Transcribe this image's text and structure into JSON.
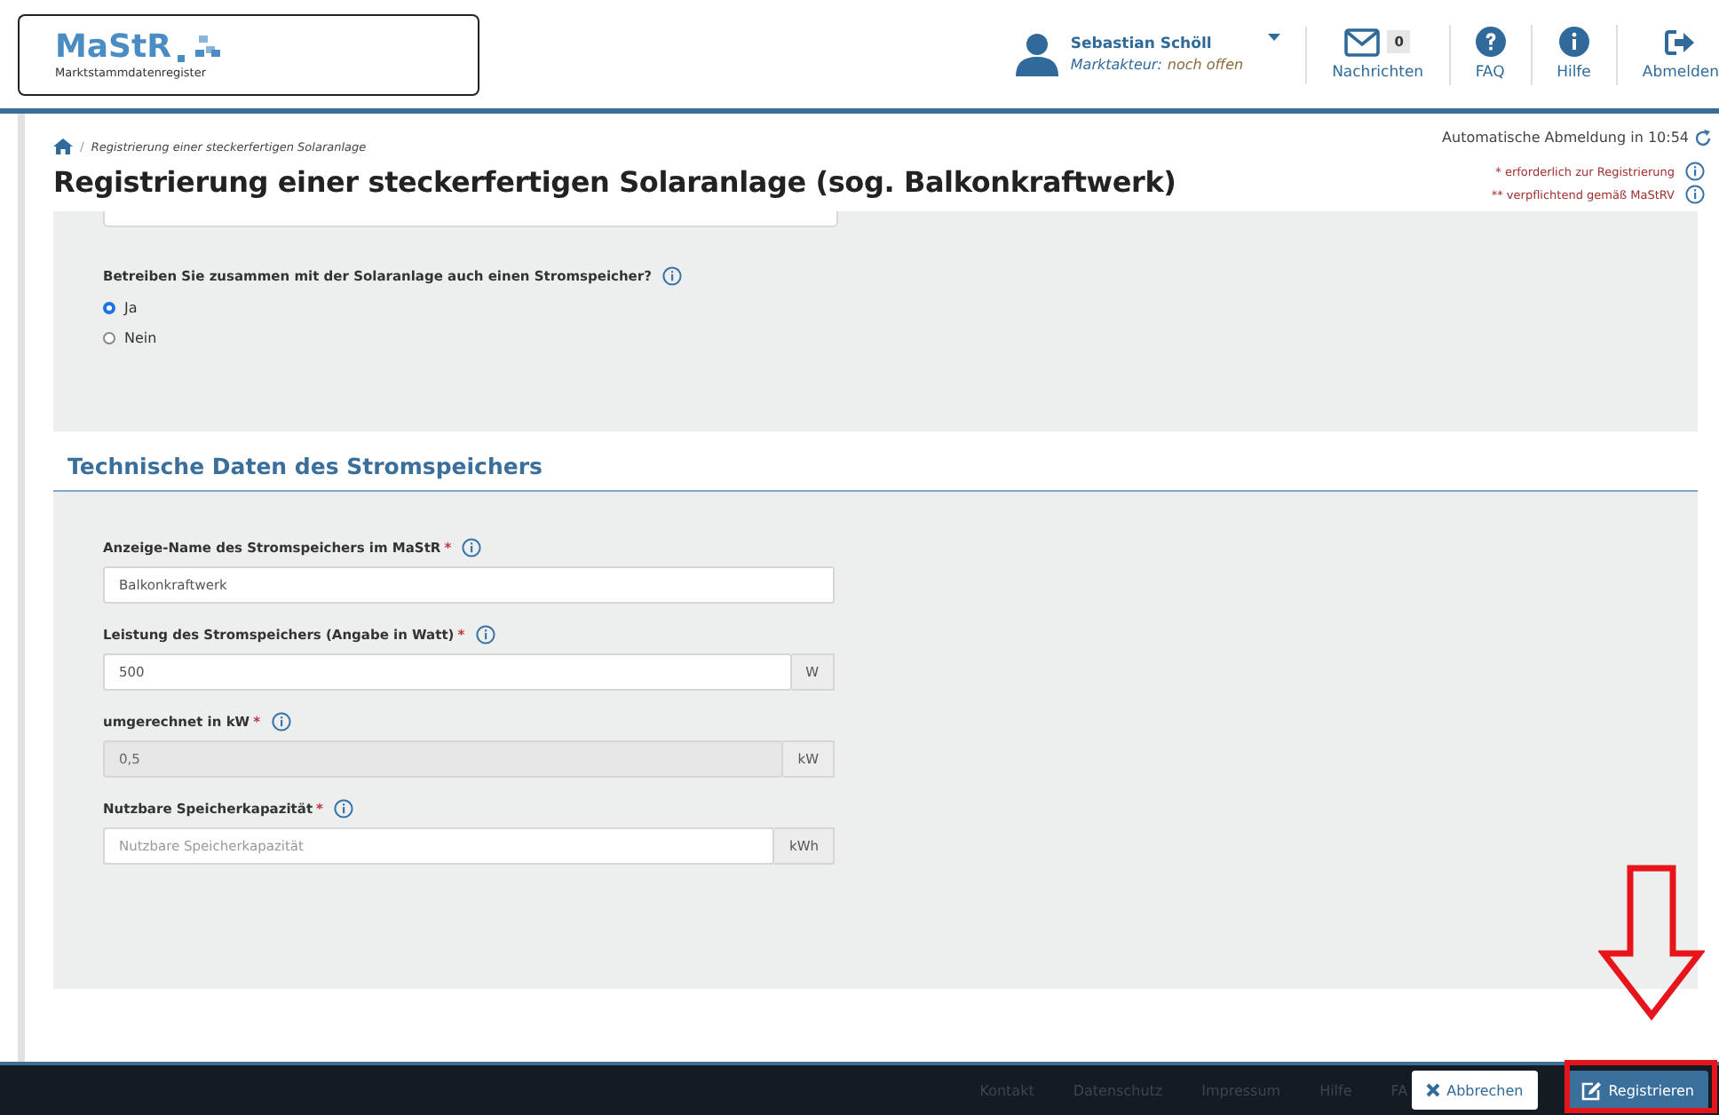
{
  "header": {
    "logo": {
      "title": "MaStR",
      "subtitle": "Marktstammdatenregister"
    },
    "user": {
      "name": "Sebastian Schöll",
      "role_label": "Marktakteur:",
      "role_value": "noch offen"
    },
    "nav": [
      {
        "kind": "mail",
        "label": "Nachrichten",
        "badge": "0"
      },
      {
        "kind": "question",
        "label": "FAQ"
      },
      {
        "kind": "info",
        "label": "Hilfe"
      },
      {
        "kind": "logout",
        "label": "Abmelden"
      }
    ]
  },
  "session_timer": "Automatische Abmeldung in 10:54",
  "breadcrumb_separator": "/",
  "breadcrumb": "Registrierung einer steckerfertigen Solaranlage",
  "page_title": "Registrierung einer steckerfertigen Solaranlage (sog. Balkonkraftwerk)",
  "legend": [
    "* erforderlich zur Registrierung",
    "** verpflichtend gemäß MaStRV"
  ],
  "question": {
    "label": "Betreiben Sie zusammen mit der Solaranlage auch einen Stromspeicher?",
    "options": [
      {
        "label": "Ja",
        "selected": true
      },
      {
        "label": "Nein",
        "selected": false
      }
    ]
  },
  "section_title": "Technische Daten des Stromspeichers",
  "fields": [
    {
      "label": "Anzeige-Name des Stromspeichers im MaStR",
      "required_mark": "*",
      "value": "Balkonkraftwerk",
      "disabled": false
    },
    {
      "label": "Leistung des Stromspeichers (Angabe in Watt)",
      "required_mark": "*",
      "value": "500",
      "unit": "W",
      "disabled": false
    },
    {
      "label": "umgerechnet in kW",
      "required_mark": "*",
      "value": "0,5",
      "unit": "kW",
      "disabled": true
    },
    {
      "label": "Nutzbare Speicherkapazität",
      "required_mark": "*",
      "placeholder": "Nutzbare Speicherkapazität",
      "unit": "kWh",
      "disabled": false
    }
  ],
  "footer": {
    "links": [
      "Kontakt",
      "Datenschutz",
      "Impressum",
      "Hilfe",
      "FA"
    ],
    "buttons": [
      {
        "kind": "cancel",
        "label": "Abbrechen"
      },
      {
        "kind": "submit",
        "label": "Registrieren"
      }
    ]
  }
}
